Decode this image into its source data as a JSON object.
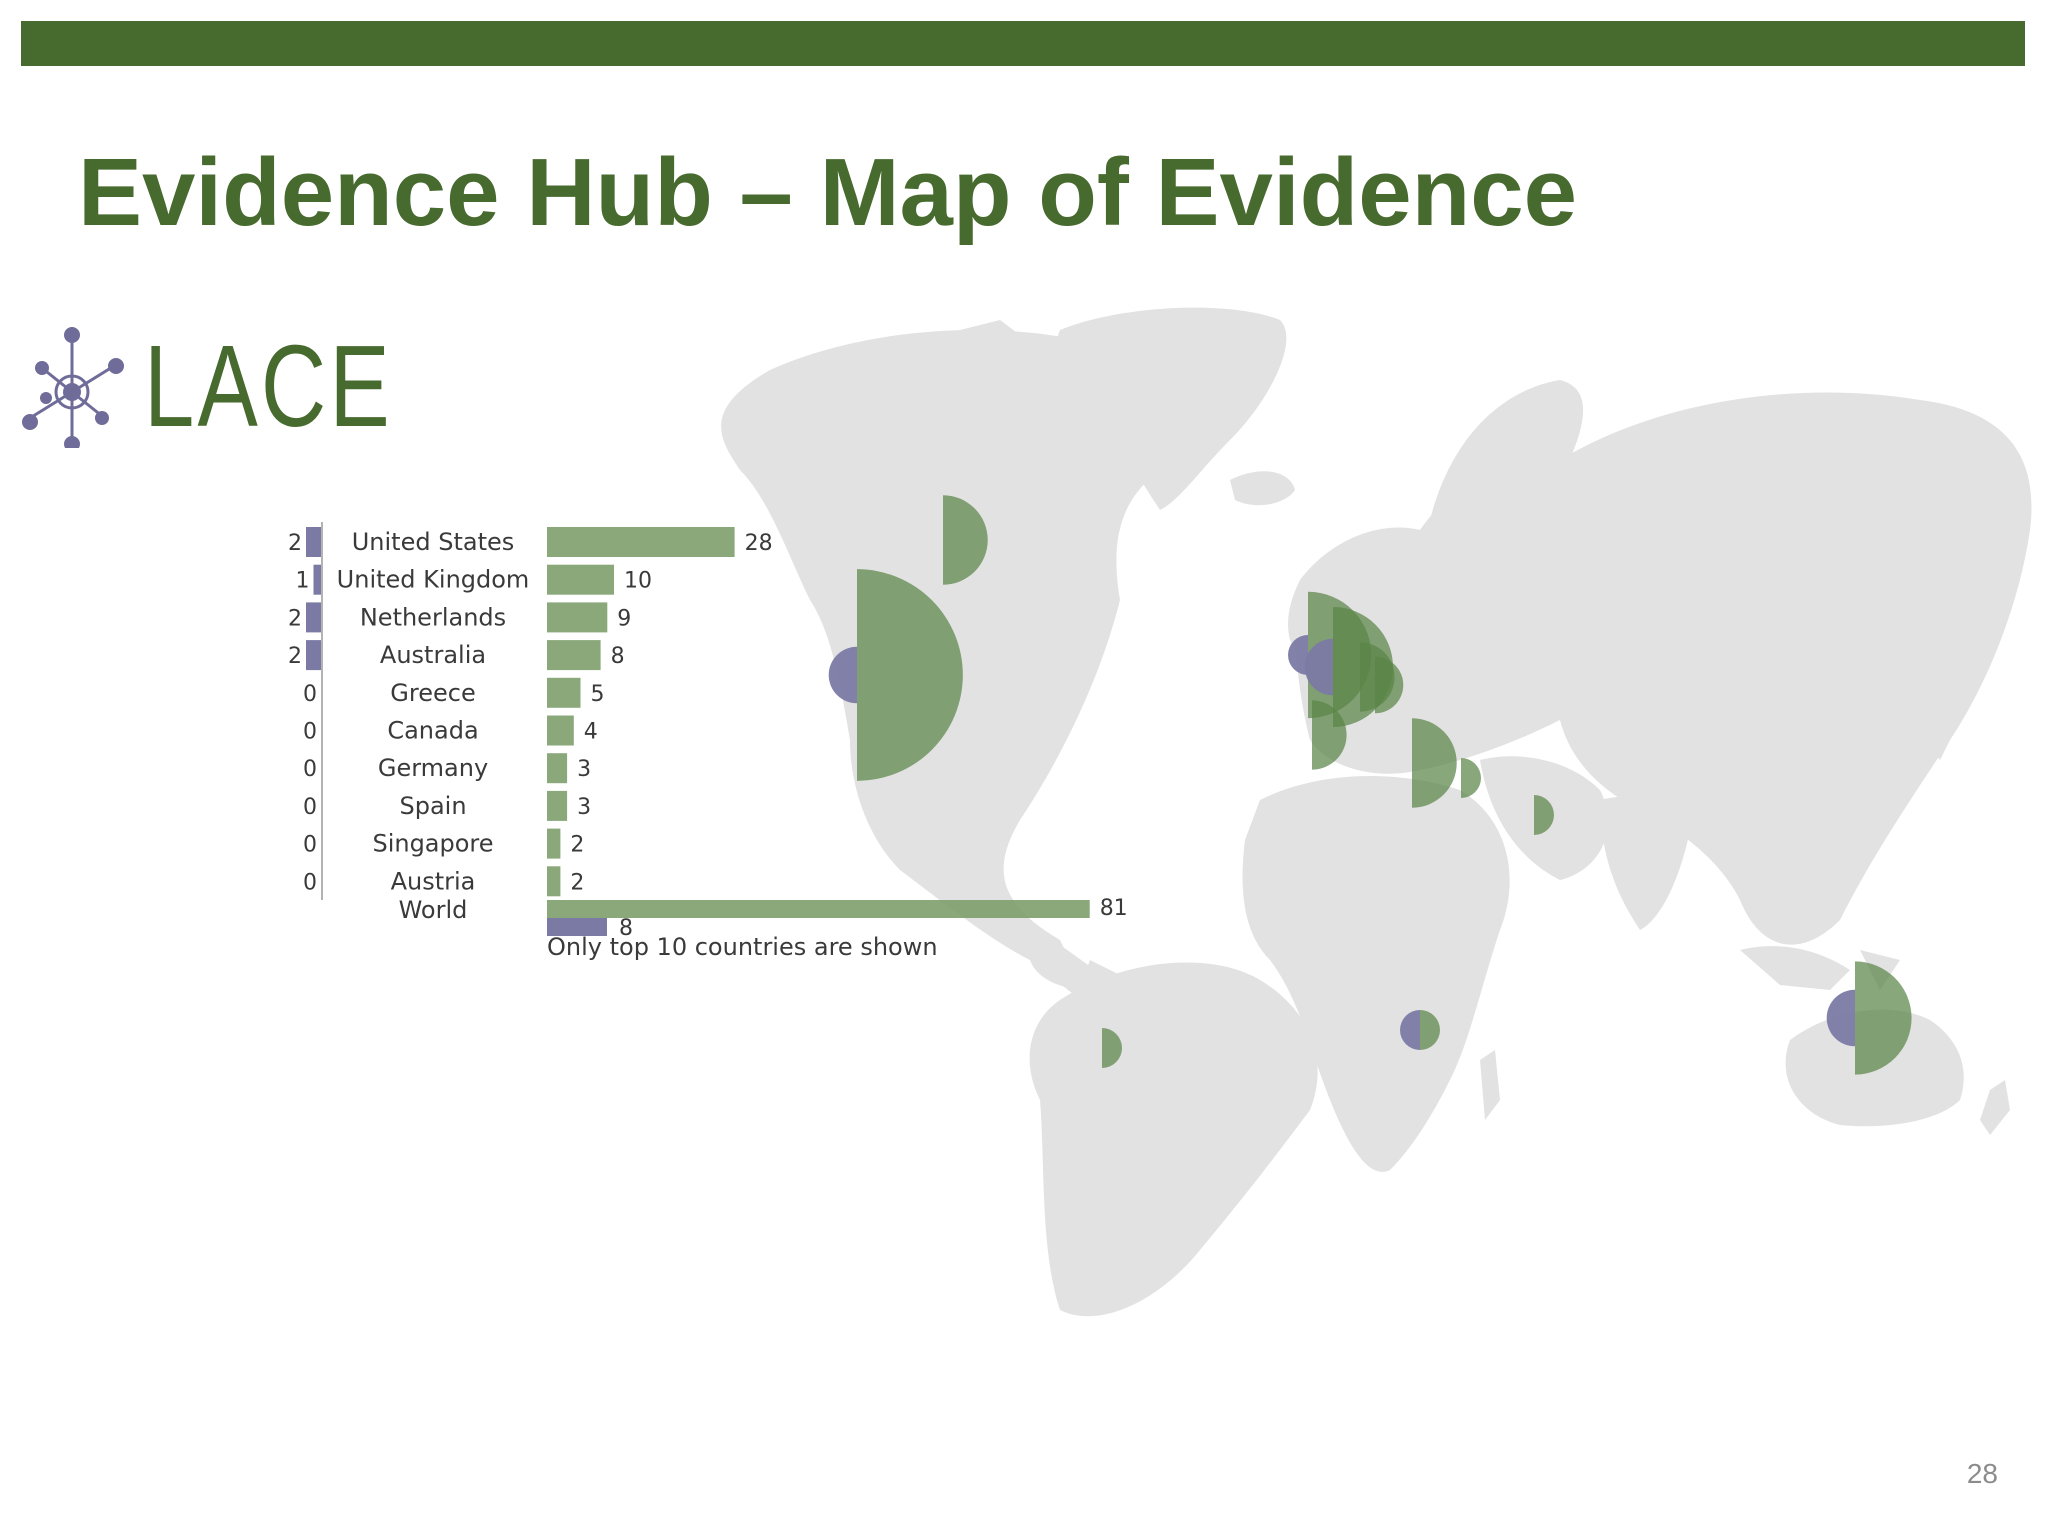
{
  "slide": {
    "title": "Evidence Hub – Map of Evidence",
    "page_number": "28",
    "logo_text": "LACE",
    "accent_color": "#476a2e"
  },
  "chart_data": {
    "type": "bar",
    "title": "",
    "xlabel": "",
    "ylabel": "",
    "categories": [
      "United States",
      "United Kingdom",
      "Netherlands",
      "Australia",
      "Greece",
      "Canada",
      "Germany",
      "Spain",
      "Singapore",
      "Austria",
      "World"
    ],
    "series": [
      {
        "values": [
          28,
          10,
          9,
          8,
          5,
          4,
          3,
          3,
          2,
          2,
          81
        ],
        "color": "#7d9e6b"
      },
      {
        "values": [
          2,
          1,
          2,
          2,
          0,
          0,
          0,
          0,
          0,
          0,
          8
        ],
        "color": "#7b7aa5"
      }
    ],
    "note": "Only top 10 countries are shown",
    "map_markers": [
      {
        "location": "north america",
        "green": 28,
        "purple": 2
      },
      {
        "location": "greenland",
        "green": 5,
        "purple": 0
      },
      {
        "location": "uk",
        "green": 10,
        "purple": 1
      },
      {
        "location": "netherlands",
        "green": 9,
        "purple": 2
      },
      {
        "location": "germany",
        "green": 3,
        "purple": 0
      },
      {
        "location": "austria",
        "green": 2,
        "purple": 0
      },
      {
        "location": "spain",
        "green": 3,
        "purple": 0
      },
      {
        "location": "greece",
        "green": 5,
        "purple": 0
      },
      {
        "location": "middle east",
        "green": 1,
        "purple": 0
      },
      {
        "location": "india",
        "green": 1,
        "purple": 0
      },
      {
        "location": "brazil",
        "green": 1,
        "purple": 0
      },
      {
        "location": "south africa",
        "green": 1,
        "purple": 1
      },
      {
        "location": "australia",
        "green": 8,
        "purple": 2
      }
    ]
  }
}
